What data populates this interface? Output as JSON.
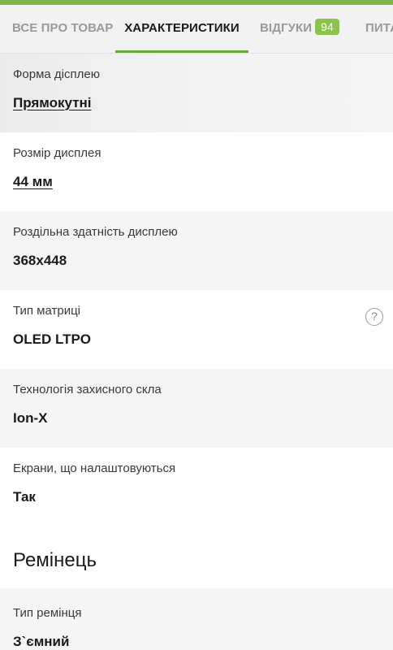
{
  "tabs": [
    {
      "label": "ВСЕ ПРО ТОВАР",
      "active": false
    },
    {
      "label": "ХАРАКТЕРИСТИКИ",
      "active": true
    },
    {
      "label": "ВІДГУКИ",
      "active": false,
      "badge": "94"
    },
    {
      "label": "ПИТА",
      "active": false
    }
  ],
  "specs": [
    {
      "label": "Форма дісплею",
      "value": "Прямокутні"
    },
    {
      "label": "Розмір дисплея",
      "value": "44 мм"
    },
    {
      "label": "Роздільна здатність дисплею",
      "value": "368x448"
    },
    {
      "label": "Тип матриці",
      "value": "OLED LTPO",
      "help_icon": "question-circle-icon"
    },
    {
      "label": "Технологія захисного скла",
      "value": "Ion-X"
    },
    {
      "label": "Екрани, що налаштовуються",
      "value": "Так"
    }
  ],
  "strap_section": {
    "title": "Ремінець",
    "specs": [
      {
        "label": "Тип ремінця",
        "value": "З`ємний"
      }
    ]
  },
  "colors": {
    "accent": "#69a83c",
    "badge": "#8bc34a",
    "shaded_row": "#f5f5f5"
  }
}
